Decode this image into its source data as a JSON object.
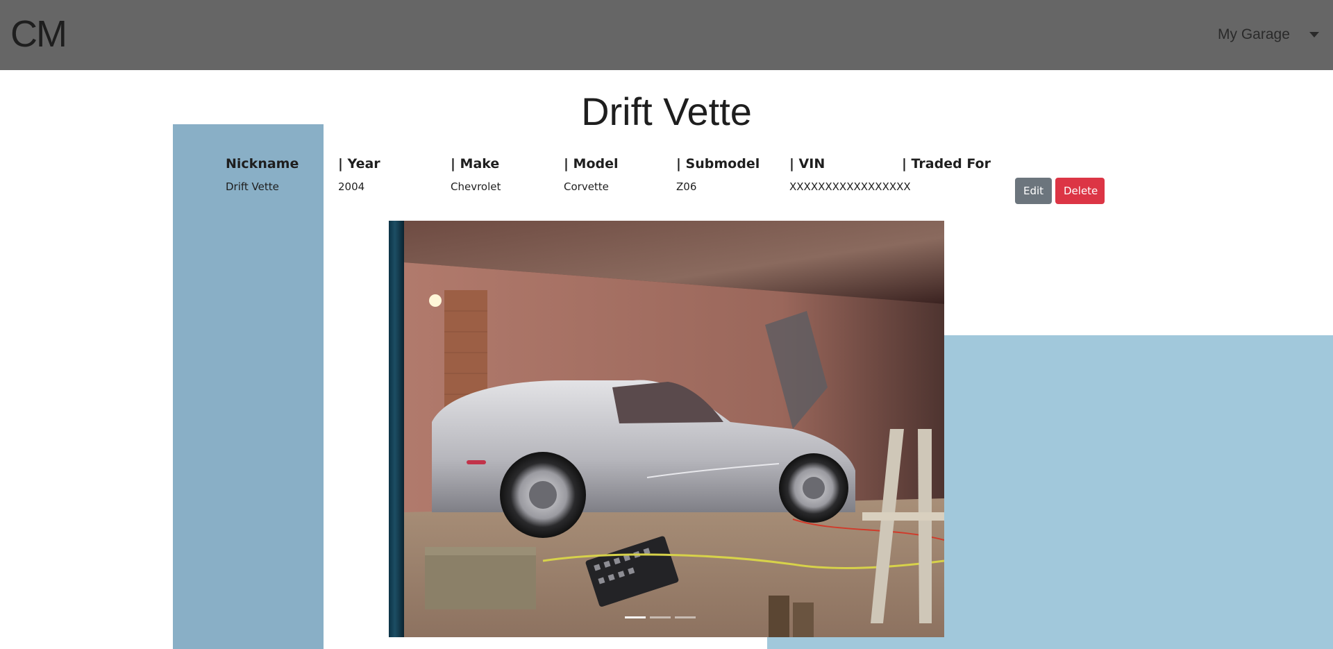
{
  "navbar": {
    "brand": "CM",
    "menu_label": "My Garage"
  },
  "page": {
    "title": "Drift Vette"
  },
  "details": {
    "headers": [
      "Nickname",
      "| Year",
      "| Make",
      "| Model",
      "| Submodel",
      "| VIN",
      "| Traded For"
    ],
    "values": [
      "Drift Vette",
      "2004",
      "Chevrolet",
      "Corvette",
      "Z06",
      "XXXXXXXXXXXXXXXXX",
      ""
    ]
  },
  "actions": {
    "edit_label": "Edit",
    "delete_label": "Delete"
  },
  "carousel": {
    "slides": 3,
    "active_slide": 1,
    "image_description_icon": "car-photo"
  },
  "colors": {
    "navbar": "#666666",
    "sidebar": "#89afc6",
    "right_panel": "#a1c8db",
    "edit_button": "#6c757d",
    "delete_button": "#dc3545"
  }
}
